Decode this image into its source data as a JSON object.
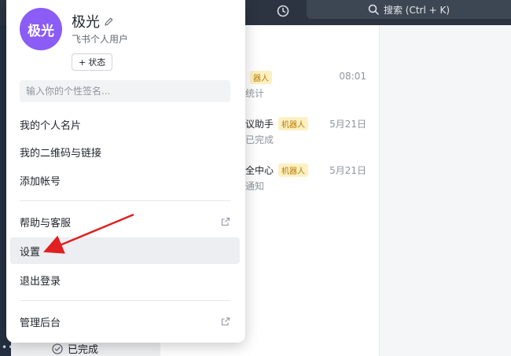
{
  "topbar": {
    "search_placeholder": "搜索 (Ctrl + K)",
    "history_icon": "history-clock-icon",
    "search_icon": "search-icon"
  },
  "chats": [
    {
      "name_partial": "",
      "tag": "器人",
      "subtitle": "统计",
      "time": "08:01"
    },
    {
      "name_partial": "议助手",
      "tag": "机器人",
      "subtitle": "已完成",
      "time": "5月21日"
    },
    {
      "name_partial": "全中心",
      "tag": "机器人",
      "subtitle": "通知",
      "time": "5月21日"
    }
  ],
  "bottom_status": {
    "label": "已完成",
    "icon": "check-circle-icon"
  },
  "profile": {
    "avatar_text": "极光",
    "avatar_color": "#8b5cf6",
    "name": "极光",
    "subtitle": "飞书个人用户",
    "status_button": "状态",
    "signature_placeholder": "输入你的个性签名..."
  },
  "menu": {
    "business_card": "我的个人名片",
    "qr_link": "我的二维码与链接",
    "add_account": "添加帐号",
    "help": "帮助与客服",
    "settings": "设置",
    "logout": "退出登录",
    "admin": "管理后台"
  },
  "colors": {
    "annotation_arrow": "#e02020",
    "topbar": "#2b3440",
    "bot_tag_bg": "#fdf0c2"
  }
}
